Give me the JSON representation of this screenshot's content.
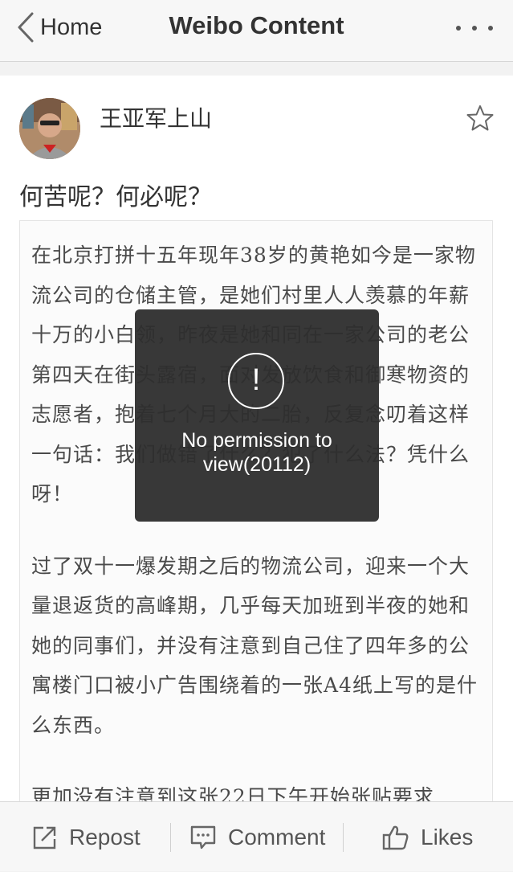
{
  "navbar": {
    "back_label": "Home",
    "title": "Weibo Content",
    "more_icon": "ellipsis-icon"
  },
  "post": {
    "username": "王亚军上山",
    "text": "何苦呢？何必呢？",
    "article_paragraphs": [
      "在北京打拼十五年现年38岁的黄艳如今是一家物流公司的仓储主管，是她们村里人人羡慕的年薪十万的小白领，昨夜是她和同在一家公司的老公第四天在街头露宿，面对发放饮食和御寒物资的志愿者，抱着七个月大的二胎，反复念叨着这样一句话：我们做错了什么？犯了什么法？凭什么呀！",
      "过了双十一爆发期之后的物流公司，迎来一个大量退返货的高峰期，几乎每天加班到半夜的她和她的同事们，并没有注意到自己住了四年多的公寓楼门口被小广告围绕着的一张A4纸上写的是什么东西。",
      "更加没有注意到这张22日下午开始张贴要求"
    ]
  },
  "toast": {
    "message": "No permission to view(20112)",
    "icon_symbol": "!"
  },
  "toolbar": {
    "repost_label": "Repost",
    "comment_label": "Comment",
    "likes_label": "Likes"
  },
  "colors": {
    "text": "#333333",
    "toast_bg": "#2d2d2d",
    "bar_bg": "#f7f7f7"
  }
}
